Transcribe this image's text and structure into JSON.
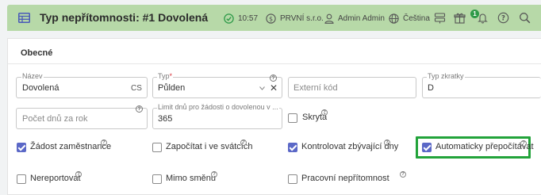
{
  "header": {
    "title": "Typ nepřítomnosti: #1 Dovolená",
    "time": "10:57",
    "company": "PRVNÍ s.r.o.",
    "user": "Admin Admin",
    "language": "Čeština",
    "notification_badge": "1",
    "accent_color": "#b7d9a8"
  },
  "section": {
    "title": "Obecné"
  },
  "fields": {
    "nazev": {
      "label": "Název",
      "value": "Dovolená",
      "suffix": "CS"
    },
    "typ": {
      "label": "Typ",
      "required_mark": "*",
      "value": "Půlden",
      "clear": "✕"
    },
    "externi_kod": {
      "placeholder": "Externí kód"
    },
    "typ_zkratky": {
      "label": "Typ zkratky",
      "value": "D"
    },
    "pocet_dnu": {
      "placeholder": "Počet dnů za rok"
    },
    "limit_dnu": {
      "label": "Limit dnů pro žádosti o dovolenou v ...",
      "value": "365"
    }
  },
  "help_glyph": "?",
  "checkboxes": {
    "skryta": {
      "label": "Skrytá",
      "checked": false
    },
    "zadost_zamestnance": {
      "label": "Žádost zaměstnance",
      "checked": true
    },
    "zapocitat_svatky": {
      "label": "Započítat i ve svátcích",
      "checked": false
    },
    "kontrolovat_dny": {
      "label": "Kontrolovat zbývající dny",
      "checked": true
    },
    "automaticky_prepocitavat": {
      "label": "Automaticky přepočítávat",
      "checked": true
    },
    "nereportovat": {
      "label": "Nereportovat",
      "checked": false
    },
    "mimo_smenu": {
      "label": "Mimo směnu",
      "checked": false
    },
    "pracovni_nepritomnost": {
      "label": "Pracovní nepřítomnost",
      "checked": false
    }
  },
  "colors": {
    "checkbox_checked": "#5b68c7",
    "highlight": "#22a33a"
  }
}
